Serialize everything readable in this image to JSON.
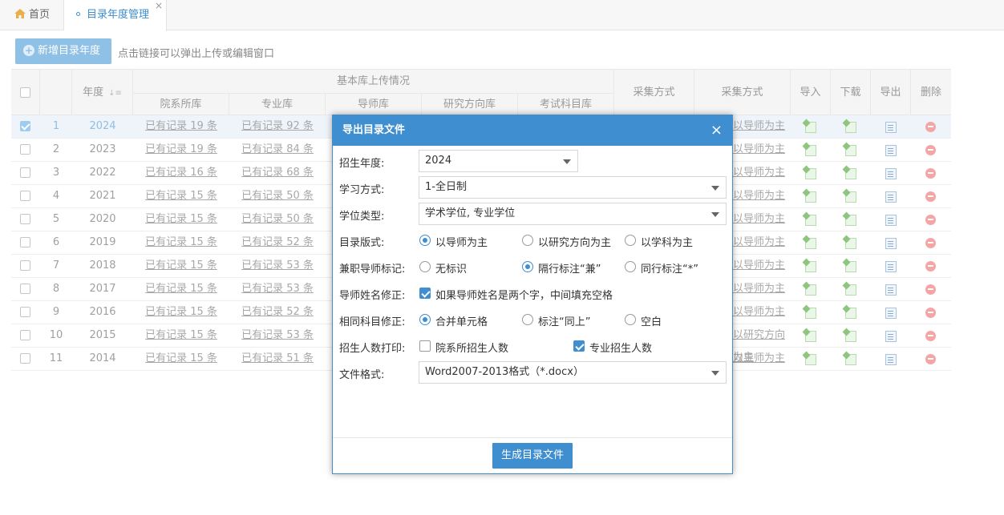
{
  "tabs": {
    "home": "首页",
    "active": "目录年度管理",
    "close": "×"
  },
  "toolbar": {
    "add_label": "新增目录年度",
    "hint": "点击链接可以弹出上传或编辑窗口"
  },
  "table": {
    "headers": {
      "year": "年度",
      "group_basic": "基本库上传情况",
      "dept": "院系所库",
      "major": "专业库",
      "tutor": "导师库",
      "direction": "研究方向库",
      "subject": "考试科目库",
      "collect1": "采集方式",
      "collect2": "采集方式",
      "import": "导入",
      "download": "下载",
      "export": "导出",
      "delete": "删除"
    },
    "rows": [
      {
        "num": "1",
        "year": "2024",
        "dept": "已有记录 19 条",
        "major": "已有记录 92 条",
        "mode": "以导师为主",
        "checked": true
      },
      {
        "num": "2",
        "year": "2023",
        "dept": "已有记录 19 条",
        "major": "已有记录 84 条",
        "mode": "以导师为主",
        "checked": false
      },
      {
        "num": "3",
        "year": "2022",
        "dept": "已有记录 16 条",
        "major": "已有记录 68 条",
        "mode": "以导师为主",
        "checked": false
      },
      {
        "num": "4",
        "year": "2021",
        "dept": "已有记录 15 条",
        "major": "已有记录 50 条",
        "mode": "以导师为主",
        "checked": false
      },
      {
        "num": "5",
        "year": "2020",
        "dept": "已有记录 15 条",
        "major": "已有记录 50 条",
        "mode": "以导师为主",
        "checked": false
      },
      {
        "num": "6",
        "year": "2019",
        "dept": "已有记录 15 条",
        "major": "已有记录 52 条",
        "mode": "以导师为主",
        "checked": false
      },
      {
        "num": "7",
        "year": "2018",
        "dept": "已有记录 15 条",
        "major": "已有记录 53 条",
        "mode": "以导师为主",
        "checked": false
      },
      {
        "num": "8",
        "year": "2017",
        "dept": "已有记录 15 条",
        "major": "已有记录 53 条",
        "mode": "以导师为主",
        "checked": false
      },
      {
        "num": "9",
        "year": "2016",
        "dept": "已有记录 15 条",
        "major": "已有记录 52 条",
        "mode": "以导师为主",
        "checked": false
      },
      {
        "num": "10",
        "year": "2015",
        "dept": "已有记录 15 条",
        "major": "已有记录 53 条",
        "mode": "以研究方向为主",
        "checked": false
      },
      {
        "num": "11",
        "year": "2014",
        "dept": "已有记录 15 条",
        "major": "已有记录 51 条",
        "mode": "以导师为主",
        "checked": false
      }
    ]
  },
  "dialog": {
    "title": "导出目录文件",
    "close": "×",
    "year_label": "招生年度:",
    "year_value": "2024",
    "study_label": "学习方式:",
    "study_value": "1-全日制",
    "degree_label": "学位类型:",
    "degree_value": "学术学位, 专业学位",
    "format_label": "目录版式:",
    "format_opt1": "以导师为主",
    "format_opt2": "以研究方向为主",
    "format_opt3": "以学科为主",
    "parttime_label": "兼职导师标记:",
    "parttime_opt1": "无标识",
    "parttime_opt2": "隔行标注“兼”",
    "parttime_opt3": "同行标注“*”",
    "name_label": "导师姓名修正:",
    "name_opt": "如果导师姓名是两个字，中间填充空格",
    "same_label": "相同科目修正:",
    "same_opt1": "合并单元格",
    "same_opt2": "标注“同上”",
    "same_opt3": "空白",
    "print_label": "招生人数打印:",
    "print_opt1": "院系所招生人数",
    "print_opt2": "专业招生人数",
    "file_label": "文件格式:",
    "file_value": "Word2007-2013格式（*.docx）",
    "generate": "生成目录文件"
  },
  "colors": {
    "accent": "#3f8ed0",
    "accent_light": "#8fc0e6"
  }
}
